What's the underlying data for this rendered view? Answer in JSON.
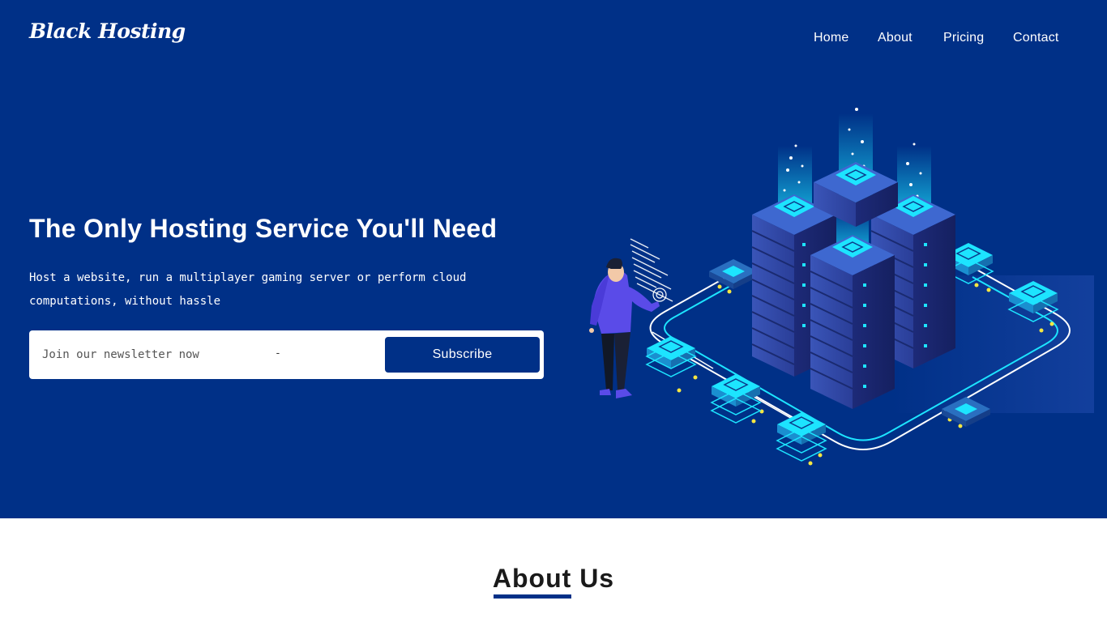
{
  "brand": {
    "name": "Black Hosting"
  },
  "nav": {
    "items": [
      {
        "label": "Home"
      },
      {
        "label": "About"
      },
      {
        "label": "Pricing"
      },
      {
        "label": "Contact"
      }
    ]
  },
  "hero": {
    "headline": "The Only Hosting Service You'll Need",
    "subtext": "Host a website, run a multiplayer gaming server or perform cloud computations, without hassle",
    "newsletter": {
      "placeholder": "Join our newsletter now",
      "separator": "-",
      "button_label": "Subscribe"
    },
    "illustration": {
      "icon": "server-datacenter-illustration"
    }
  },
  "about": {
    "title": "About Us"
  },
  "colors": {
    "primary": "#003087",
    "accent_cyan": "#1de4ff",
    "accent_purple": "#5a4be8",
    "white": "#ffffff"
  }
}
